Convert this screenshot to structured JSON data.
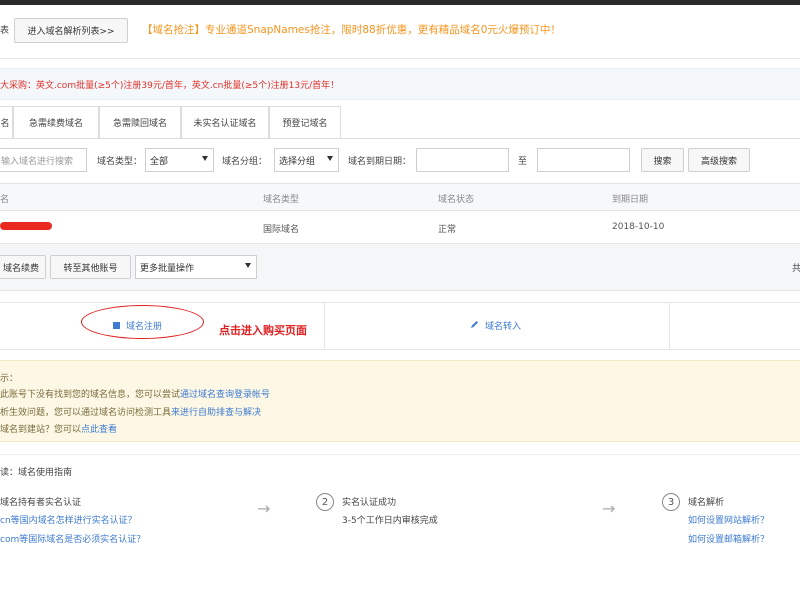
{
  "header": {
    "left_cut_label": "表",
    "enter_list_button": "进入域名解析列表>>",
    "notice": "【域名抢注】专业通道SnapNames抢注，限时88折优惠，更有精品域名0元火爆预订中！"
  },
  "promo": {
    "text": "大采购：英文.com批量(≥5个)注册39元/首年，英文.cn批量(≥5个)注册13元/首年！"
  },
  "tabs": [
    {
      "label": "名",
      "active": true
    },
    {
      "label": "急需续费域名",
      "active": false
    },
    {
      "label": "急需赎回域名",
      "active": false
    },
    {
      "label": "未实名认证域名",
      "active": false
    },
    {
      "label": "预登记域名",
      "active": false
    }
  ],
  "filters": {
    "search_placeholder": "输入域名进行搜索",
    "type_label": "域名类型：",
    "type_value": "全部",
    "group_label": "域名分组：",
    "group_value": "选择分组",
    "expire_label": "域名到期日期：",
    "range_sep": "至",
    "search_button": "搜索",
    "advanced_button": "高级搜索"
  },
  "table": {
    "headers": [
      "名",
      "域名类型",
      "域名状态",
      "到期日期"
    ],
    "rows": [
      {
        "domain": "",
        "type": "国际域名",
        "status": "正常",
        "expire": "2018-10-10"
      }
    ]
  },
  "actions": {
    "renew": "域名续费",
    "transfer_account": "转至其他账号",
    "more_batch": "更多批量操作",
    "right_cut": "共"
  },
  "cards": {
    "register": "域名注册",
    "transfer_in": "域名转入",
    "annotation": "点击进入购买页面"
  },
  "tips": {
    "title": "示：",
    "line1_prefix": "此账号下没有找到您的域名信息，您可以尝试",
    "line1_link": "通过域名查询登录帐号",
    "line2_prefix": "析生效问题，您可以通过域名访问检测工具",
    "line2_link": "来进行自助排查与解决",
    "line3_prefix": "域名到建站？您可以",
    "line3_link": "点此查看"
  },
  "guide": {
    "title": "读：域名使用指南",
    "step1": {
      "title": "域名持有者实名认证",
      "link1": "cn等国内域名怎样进行实名认证？",
      "link2": "com等国际域名是否必须实名认证？"
    },
    "step2": {
      "num": "2",
      "title": "实名认证成功",
      "desc": "3-5个工作日内审核完成"
    },
    "step3": {
      "num": "3",
      "title": "域名解析",
      "link1": "如何设置网站解析？",
      "link2": "如何设置邮箱解析？"
    },
    "arrow": "→"
  },
  "colors": {
    "accent_blue": "#3e7bd1",
    "notice_orange": "#f7941d",
    "promo_red": "#e0302a",
    "annotation_red": "#e02020",
    "tips_bg": "#fdf8e6"
  }
}
